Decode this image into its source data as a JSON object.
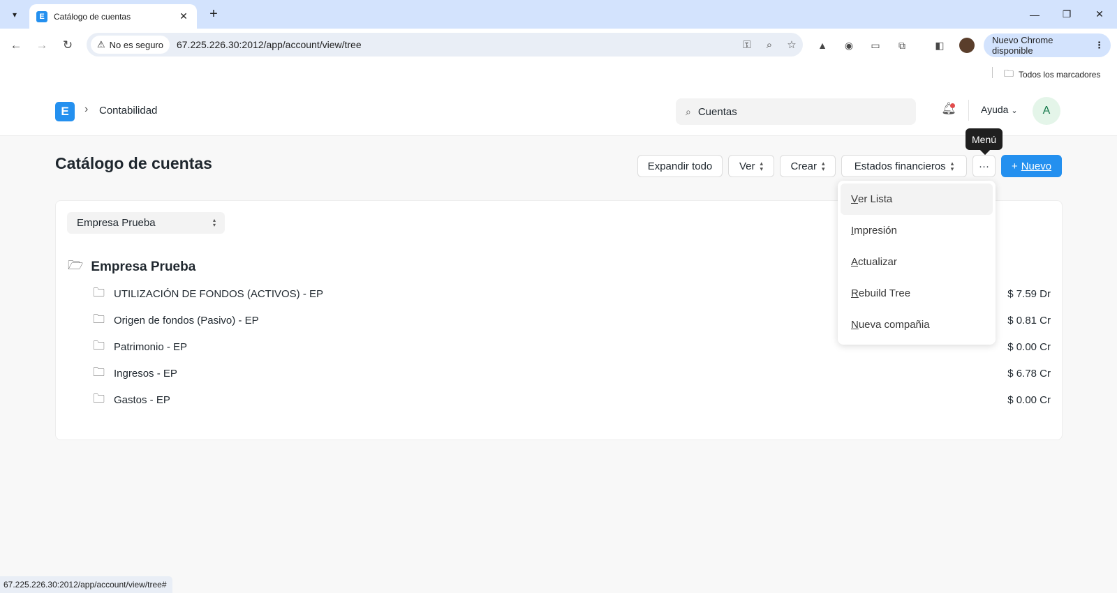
{
  "browser": {
    "tab_title": "Catálogo de cuentas",
    "security_label": "No es seguro",
    "url": "67.225.226.30:2012/app/account/view/tree",
    "update_label": "Nuevo Chrome disponible",
    "bookmarks_all_label": "Todos los marcadores",
    "status_url": "67.225.226.30:2012/app/account/view/tree#"
  },
  "navbar": {
    "breadcrumb": "Contabilidad",
    "search_value": "Cuentas",
    "help_label": "Ayuda",
    "avatar_initial": "A"
  },
  "page": {
    "title": "Catálogo de cuentas",
    "buttons": {
      "expand_all": "Expandir todo",
      "view": "Ver",
      "create": "Crear",
      "financial_statements": "Estados financieros",
      "more": "···",
      "new": "Nuevo"
    },
    "tooltip": "Menú"
  },
  "tree": {
    "company_select": "Empresa Prueba",
    "root": "Empresa Prueba",
    "rows": [
      {
        "label": "UTILIZACIÓN DE FONDOS (ACTIVOS) - EP",
        "balance": "$ 7.59 Dr"
      },
      {
        "label": "Origen de fondos (Pasivo) - EP",
        "balance": "$ 0.81 Cr"
      },
      {
        "label": "Patrimonio - EP",
        "balance": "$ 0.00 Cr"
      },
      {
        "label": "Ingresos - EP",
        "balance": "$ 6.78 Cr"
      },
      {
        "label": "Gastos - EP",
        "balance": "$ 0.00 Cr"
      }
    ]
  },
  "menu": {
    "items": [
      {
        "first": "V",
        "rest": "er Lista"
      },
      {
        "first": "I",
        "rest": "mpresión"
      },
      {
        "first": "A",
        "rest": "ctualizar"
      },
      {
        "first": "R",
        "rest": "ebuild Tree"
      },
      {
        "first": "N",
        "rest": "ueva compañia"
      }
    ]
  },
  "colors": {
    "primary": "#2490ef",
    "tabstrip": "#d3e3fd",
    "notification_dot": "#e24c4c"
  }
}
